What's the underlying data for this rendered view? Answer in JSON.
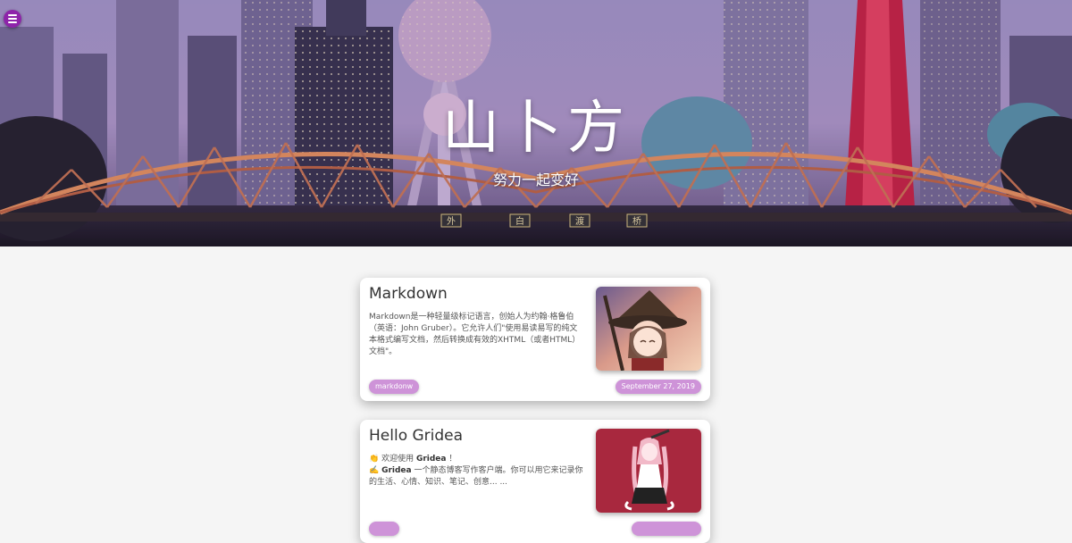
{
  "site": {
    "title": "山卜方",
    "subtitle": "努力一起变好",
    "menu_icon": "hamburger-menu-icon",
    "accent": "#8e24aa",
    "tag_color": "#ce93d8"
  },
  "hero": {
    "bridge_sign": [
      "外",
      "白",
      "渡",
      "桥"
    ]
  },
  "posts": [
    {
      "title": "Markdown",
      "excerpt_lines": [
        "Markdown是一种轻量级标记语言，创始人为约翰·格鲁伯",
        "（英语：John Gruber）。它允许人们\"使用易读易写的纯文",
        "本格式编写文档，然后转换成有效的XHTML（或者HTML）",
        "文档\"。"
      ],
      "tag": "markdonw",
      "date": "September 27, 2019"
    },
    {
      "title": "Hello Gridea",
      "excerpt_line1_prefix": "👏 欢迎使用 ",
      "excerpt_line1_bold": "Gridea",
      "excerpt_line1_suffix": " ！",
      "excerpt_line2_prefix": "✍️ ",
      "excerpt_line2_bold": "Gridea",
      "excerpt_line2_suffix": " 一个静态博客写作客户端。你可以用它来记录你",
      "excerpt_line3": "的生活、心情、知识、笔记、创意... ..."
    }
  ]
}
